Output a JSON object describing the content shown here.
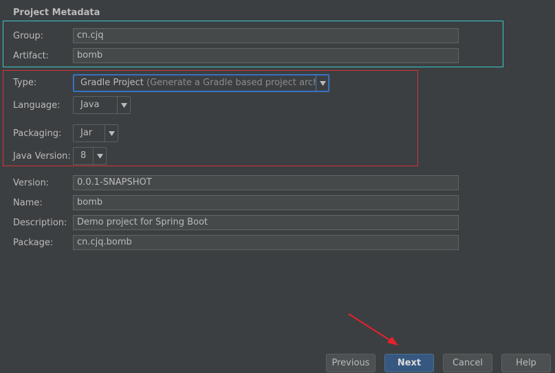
{
  "section": {
    "title": "Project Metadata"
  },
  "fields": {
    "group": {
      "label": "Group:",
      "value": "cn.cjq"
    },
    "artifact": {
      "label": "Artifact:",
      "value": "bomb"
    },
    "version": {
      "label": "Version:",
      "value": "0.0.1-SNAPSHOT"
    },
    "name": {
      "label": "Name:",
      "value": "bomb"
    },
    "description": {
      "label": "Description:",
      "value": "Demo project for Spring Boot"
    },
    "package": {
      "label": "Package:",
      "value": "cn.cjq.bomb"
    }
  },
  "combos": {
    "type": {
      "label": "Type:",
      "value": "Gradle Project",
      "hint": "(Generate a Gradle based project archive)"
    },
    "language": {
      "label": "Language:",
      "value": "Java"
    },
    "packaging": {
      "label": "Packaging:",
      "value": "Jar"
    },
    "javaVersion": {
      "label": "Java Version:",
      "value": "8"
    }
  },
  "buttons": {
    "previous": "Previous",
    "next": "Next",
    "cancel": "Cancel",
    "help": "Help"
  },
  "colors": {
    "background": "#3c3f41",
    "highlight_cyan": "#3ac9cf",
    "highlight_red": "#d6353a",
    "annotation_arrow": "#e8212b",
    "default_button": "#365880"
  }
}
